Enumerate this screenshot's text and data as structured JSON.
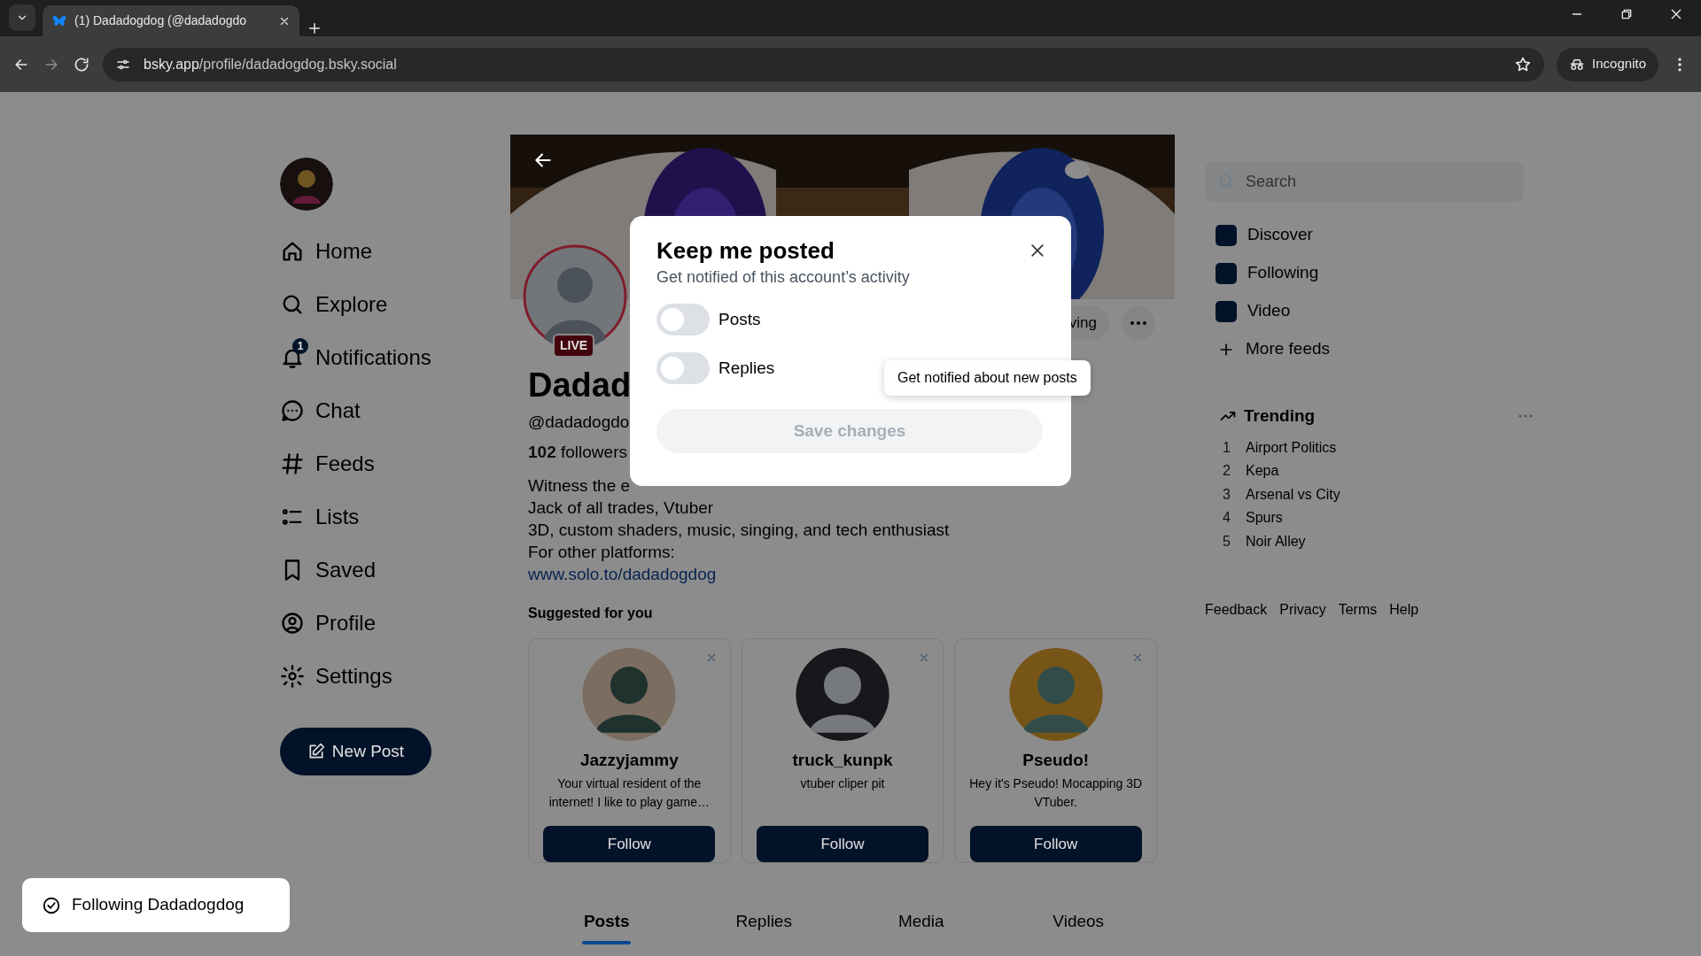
{
  "browser": {
    "tab_title": "(1) Dadadogdog (@dadadogdo",
    "address_host": "bsky.app",
    "address_path": "/profile/dadadogdog.bsky.social",
    "incognito": "Incognito"
  },
  "nav": {
    "items": [
      {
        "label": "Home"
      },
      {
        "label": "Explore"
      },
      {
        "label": "Notifications",
        "badge": "1"
      },
      {
        "label": "Chat"
      },
      {
        "label": "Feeds"
      },
      {
        "label": "Lists"
      },
      {
        "label": "Saved"
      },
      {
        "label": "Profile"
      },
      {
        "label": "Settings"
      }
    ],
    "new_post": "New Post"
  },
  "profile": {
    "live_badge": "LIVE",
    "following_button": "ving",
    "name": "Dadad",
    "handle": "@dadadogdo",
    "followers": "**102** followers",
    "bio": [
      "Witness the e",
      "Jack of all trades, Vtuber",
      "3D, custom shaders, music, singing, and tech enthusiast",
      "For other platforms:"
    ],
    "link": "www.solo.to/dadadogdog"
  },
  "suggested": {
    "title": "Suggested for you",
    "cards": [
      {
        "name": "Jazzyjammy",
        "description": "Your virtual resident of the internet! I like to play game…",
        "follow": "Follow"
      },
      {
        "name": "truck_kunpk",
        "description": "vtuber cliper pit",
        "follow": "Follow"
      },
      {
        "name": "Pseudo!",
        "description": "Hey it's Pseudo! Mocapping 3D VTuber.",
        "follow": "Follow"
      }
    ]
  },
  "tabs": [
    {
      "label": "Posts",
      "selected": true
    },
    {
      "label": "Replies",
      "selected": false
    },
    {
      "label": "Media",
      "selected": false
    },
    {
      "label": "Videos",
      "selected": false
    }
  ],
  "right": {
    "search": {
      "placeholder": "Search"
    },
    "feeds": [
      "Discover",
      "Following",
      "Video"
    ],
    "more_feeds": "More feeds",
    "trending": {
      "title": "Trending",
      "items": [
        {
          "rank": "1",
          "label": "Airport Politics"
        },
        {
          "rank": "2",
          "label": "Kepa"
        },
        {
          "rank": "3",
          "label": "Arsenal vs City"
        },
        {
          "rank": "4",
          "label": "Spurs"
        },
        {
          "rank": "5",
          "label": "Noir Alley"
        }
      ]
    },
    "footer": [
      "Feedback",
      "Privacy",
      "Terms",
      "Help"
    ]
  },
  "modal": {
    "title": "Keep me posted",
    "subtitle": "Get notified of this account’s activity",
    "toggles": [
      {
        "label": "Posts",
        "on": false
      },
      {
        "label": "Replies",
        "on": false
      }
    ],
    "save": {
      "label": "Save changes",
      "disabled": true
    }
  },
  "tooltip": "Get notified about new posts",
  "toast": "Following Dadadogdog"
}
